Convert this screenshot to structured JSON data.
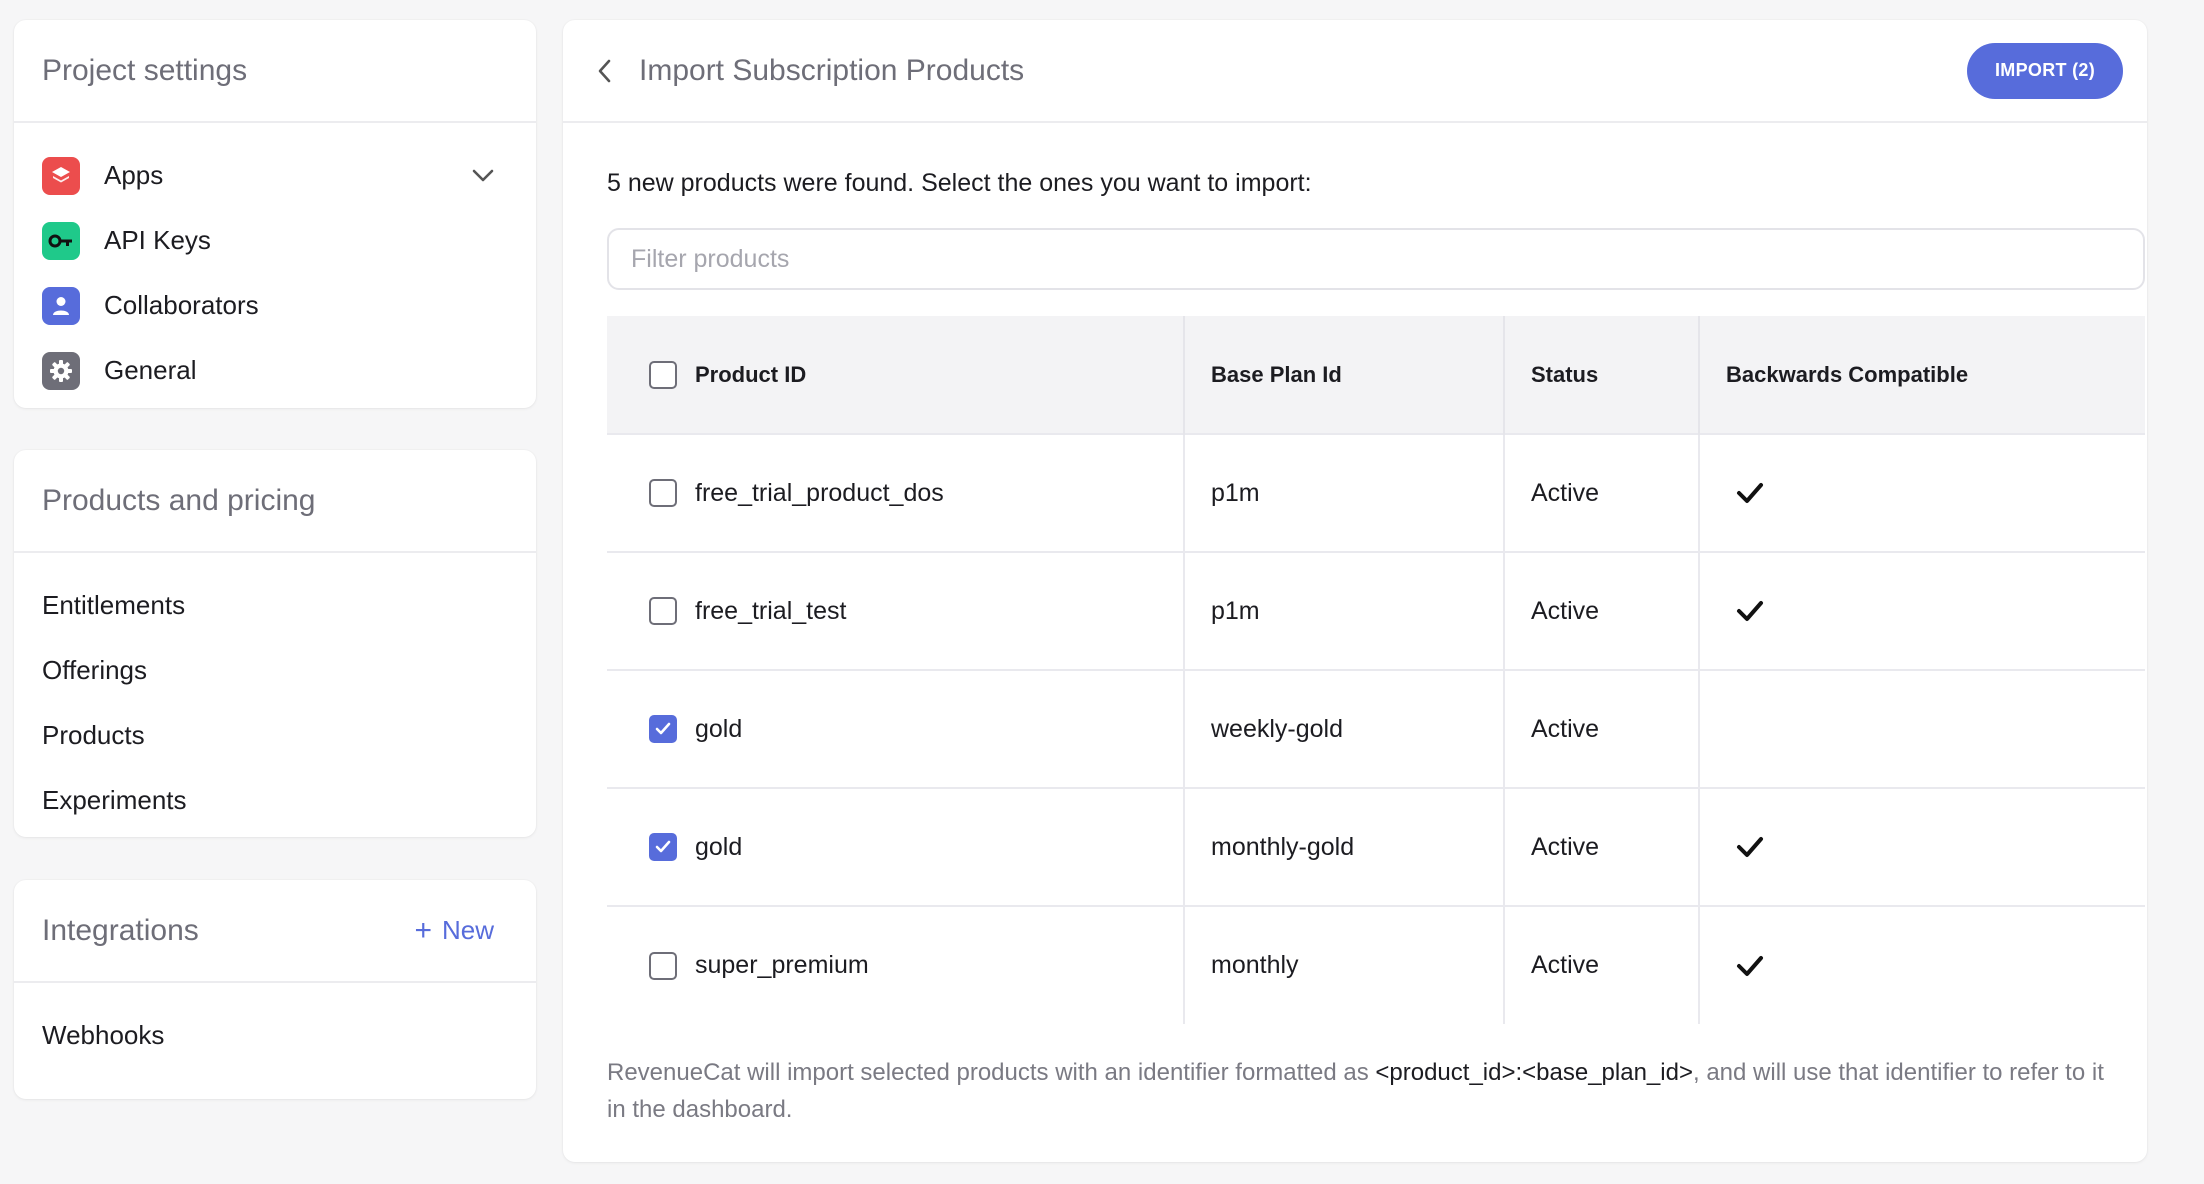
{
  "sidebar": {
    "project_settings": {
      "title": "Project settings",
      "items": [
        {
          "label": "Apps",
          "icon": "apps-icon",
          "color": "#ec4d4d"
        },
        {
          "label": "API Keys",
          "icon": "key-icon",
          "color": "#1fc98a"
        },
        {
          "label": "Collaborators",
          "icon": "user-icon",
          "color": "#576cdb"
        },
        {
          "label": "General",
          "icon": "gear-icon",
          "color": "#6e6e78"
        }
      ]
    },
    "products_pricing": {
      "title": "Products and pricing",
      "items": [
        "Entitlements",
        "Offerings",
        "Products",
        "Experiments"
      ]
    },
    "integrations": {
      "title": "Integrations",
      "new_label": "New",
      "items": [
        "Webhooks"
      ]
    }
  },
  "main": {
    "title": "Import Subscription Products",
    "import_button": "IMPORT (2)",
    "intro": "5 new products were found. Select the ones you want to import:",
    "filter_placeholder": "Filter products",
    "table": {
      "headers": [
        "Product ID",
        "Base Plan Id",
        "Status",
        "Backwards Compatible"
      ],
      "rows": [
        {
          "product_id": "free_trial_product_dos",
          "base_plan": "p1m",
          "status": "Active",
          "checked": false,
          "compatible": true
        },
        {
          "product_id": "free_trial_test",
          "base_plan": "p1m",
          "status": "Active",
          "checked": false,
          "compatible": true
        },
        {
          "product_id": "gold",
          "base_plan": "weekly-gold",
          "status": "Active",
          "checked": true,
          "compatible": false
        },
        {
          "product_id": "gold",
          "base_plan": "monthly-gold",
          "status": "Active",
          "checked": true,
          "compatible": true
        },
        {
          "product_id": "super_premium",
          "base_plan": "monthly",
          "status": "Active",
          "checked": false,
          "compatible": true
        }
      ]
    },
    "footnote": {
      "before": "RevenueCat will import selected products with an identifier formatted as ",
      "code": "<product_id>:<base_plan_id>",
      "after": ", and will use that identifier to refer to it in the dashboard."
    }
  },
  "colors": {
    "accent": "#576cdb"
  }
}
